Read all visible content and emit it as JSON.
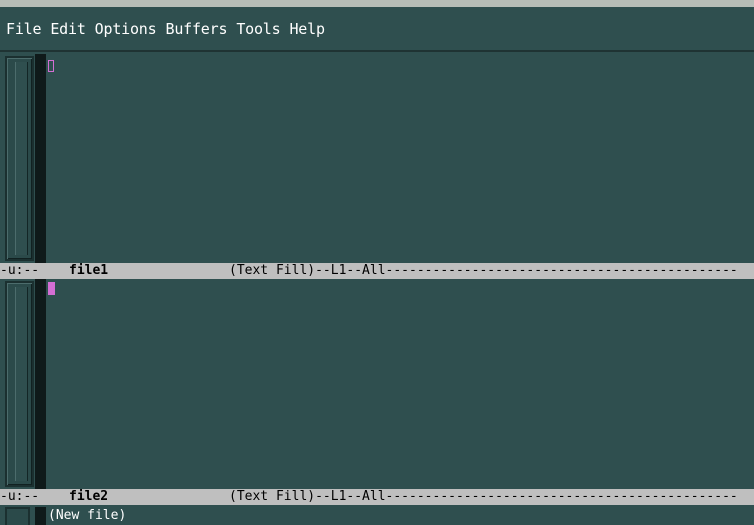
{
  "menubar": {
    "items": [
      "File",
      "Edit",
      "Options",
      "Buffers",
      "Tools",
      "Help"
    ]
  },
  "window1": {
    "modeline": {
      "flags": "-u:--",
      "buffer_name": "file1",
      "info": "(Text Fill)--L1--All---------------------------------------------"
    }
  },
  "window2": {
    "modeline": {
      "flags": "-u:--",
      "buffer_name": "file2",
      "info": "(Text Fill)--L1--All---------------------------------------------"
    }
  },
  "minibuffer": {
    "message": "(New file)"
  },
  "colors": {
    "background": "#2f4f4f",
    "modeline": "#bfbfbf",
    "cursor": "#d46ed4"
  },
  "icons": [
    "scrollbar-top",
    "scrollbar-bottom",
    "cursor-hollow",
    "cursor-solid"
  ]
}
